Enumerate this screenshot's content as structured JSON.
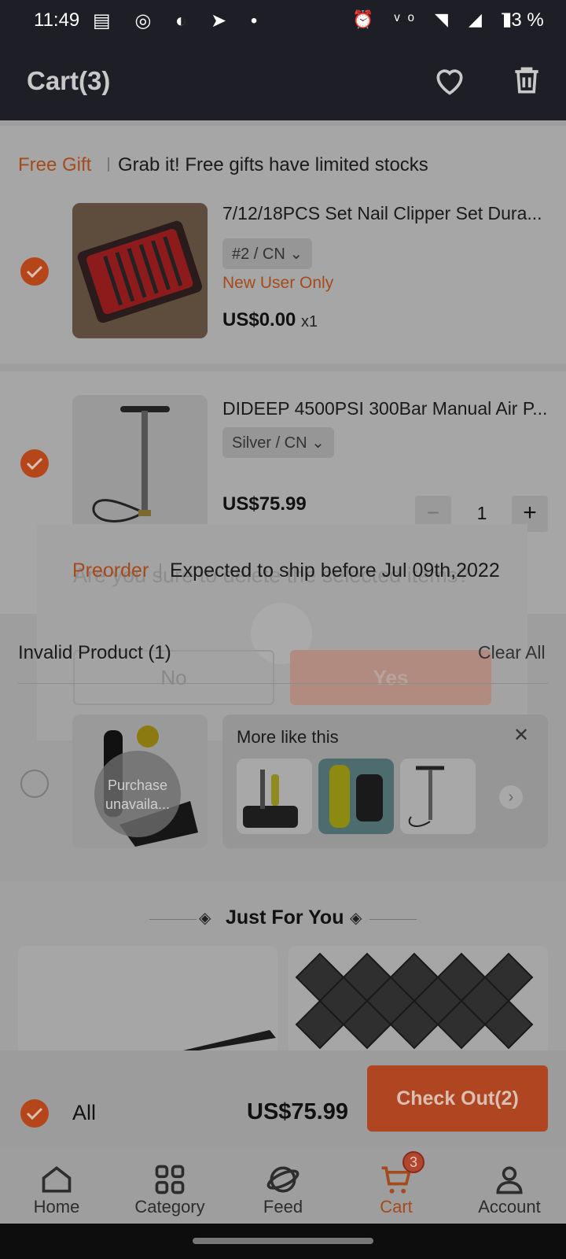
{
  "status_bar": {
    "time": "11:49",
    "battery": "73 %"
  },
  "header": {
    "title": "Cart(3)"
  },
  "free_gift": {
    "tag": "Free Gift",
    "message": "Grab it! Free gifts have limited stocks",
    "item": {
      "title": "7/12/18PCS Set Nail Clipper Set Dura...",
      "variant": "#2 / CN",
      "badge": "New User Only",
      "price": "US$0.00",
      "qty": "x1"
    }
  },
  "cart_item": {
    "title": "DIDEEP 4500PSI 300Bar Manual Air P...",
    "variant": "Silver / CN",
    "price": "US$75.99",
    "quantity": "1",
    "minus": "−",
    "plus": "+"
  },
  "preorder": {
    "tag": "Preorder",
    "message": "Expected to ship before Jul 09th,2022"
  },
  "dialog": {
    "message": "Are you sure to delete the selected items?",
    "no_label": "No",
    "yes_label": "Yes"
  },
  "invalid": {
    "heading": "Invalid Product (1)",
    "clear_all": "Clear All",
    "unavailable": "Purchase unavaila...",
    "more_like_this": "More like this"
  },
  "just_for_you": {
    "title": "Just For You"
  },
  "bottom_bar": {
    "select_all": "All",
    "total": "US$75.99",
    "checkout": "Check Out(2)"
  },
  "nav": {
    "items": [
      {
        "label": "Home",
        "icon": "home-icon"
      },
      {
        "label": "Category",
        "icon": "category-icon"
      },
      {
        "label": "Feed",
        "icon": "feed-icon"
      },
      {
        "label": "Cart",
        "icon": "cart-icon"
      },
      {
        "label": "Account",
        "icon": "account-icon"
      }
    ],
    "cart_badge": "3"
  },
  "colors": {
    "accent": "#E8622A",
    "header_bg": "#1E1F26"
  }
}
